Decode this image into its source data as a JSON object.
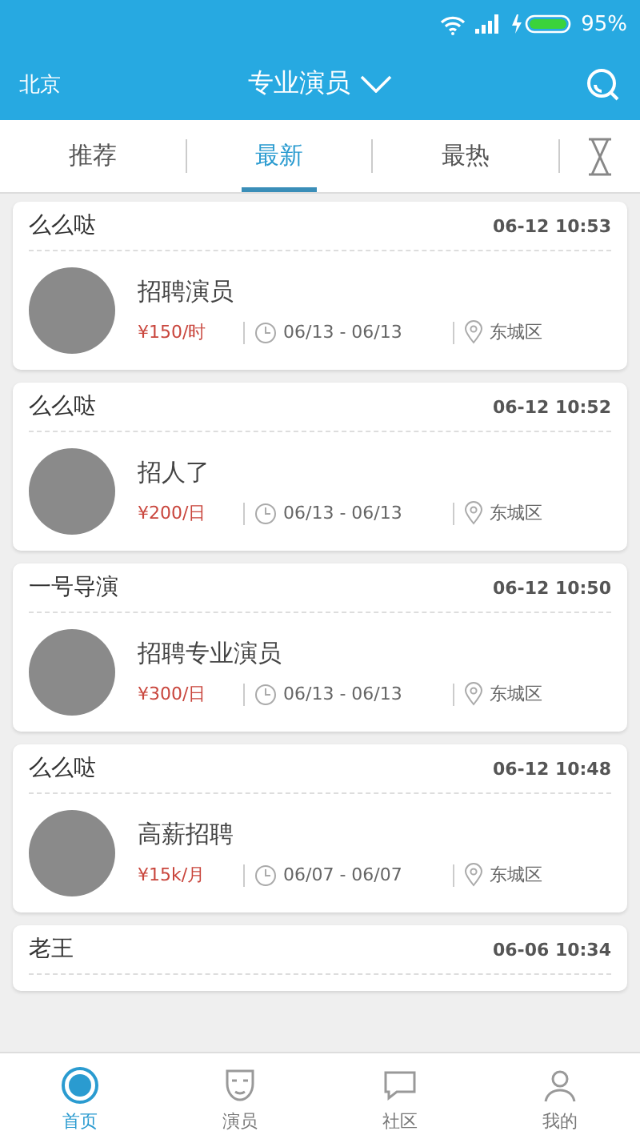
{
  "status_bar": {
    "battery": "95%"
  },
  "header": {
    "city": "北京",
    "title": "专业演员"
  },
  "tabs": [
    {
      "label": "推荐",
      "selected": false
    },
    {
      "label": "最新",
      "selected": true
    },
    {
      "label": "最热",
      "selected": false
    }
  ],
  "posts": [
    {
      "author": "么么哒",
      "time": "06-12 10:53",
      "title": "招聘演员",
      "pay": "¥150/时",
      "dates": "06/13 - 06/13",
      "district": "东城区"
    },
    {
      "author": "么么哒",
      "time": "06-12 10:52",
      "title": "招人了",
      "pay": "¥200/日",
      "dates": "06/13 - 06/13",
      "district": "东城区"
    },
    {
      "author": "一号导演",
      "time": "06-12 10:50",
      "title": "招聘专业演员",
      "pay": "¥300/日",
      "dates": "06/13 - 06/13",
      "district": "东城区"
    },
    {
      "author": "么么哒",
      "time": "06-12 10:48",
      "title": "高薪招聘",
      "pay": "¥15k/月",
      "dates": "06/07 - 06/07",
      "district": "东城区"
    },
    {
      "author": "老王",
      "time": "06-06 10:34"
    }
  ],
  "nav": [
    {
      "label": "首页",
      "kind": "home",
      "selected": true
    },
    {
      "label": "演员",
      "kind": "mask",
      "selected": false
    },
    {
      "label": "社区",
      "kind": "chat",
      "selected": false
    },
    {
      "label": "我的",
      "kind": "user",
      "selected": false
    }
  ]
}
